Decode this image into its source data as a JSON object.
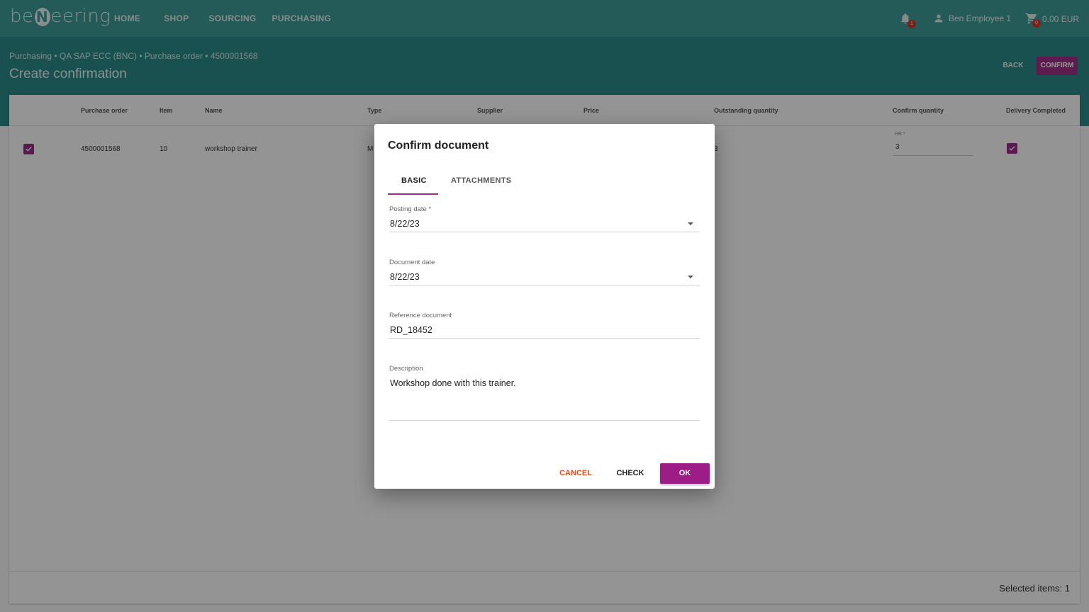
{
  "app": {
    "logo_text_left": "be",
    "logo_text_mid": "N",
    "logo_text_right": "eering"
  },
  "nav": {
    "items": [
      "HOME",
      "SHOP",
      "SOURCING",
      "PURCHASING"
    ]
  },
  "topbar": {
    "notification_count": "1",
    "user_name": "Ben Employee 1",
    "cart_count": "0",
    "cart_total": "0.00 EUR"
  },
  "header": {
    "breadcrumb": "Purchasing • QA SAP ECC (BNC) • Purchase order • 4500001568",
    "title": "Create confirmation",
    "back_label": "BACK",
    "confirm_label": "CONFIRM"
  },
  "table": {
    "columns": [
      "Purchase order",
      "Item",
      "Name",
      "Type",
      "Supplier",
      "Price",
      "Outstanding quantity",
      "Confirm quantity",
      "Delivery Completed"
    ],
    "rows": [
      {
        "selected": true,
        "purchase_order": "4500001568",
        "item": "10",
        "name": "workshop trainer",
        "type": "M",
        "outstanding_quantity": "3",
        "confirm_quantity_label": "HR *",
        "confirm_quantity": "3",
        "delivery_completed": true
      }
    ]
  },
  "footer": {
    "selected_items": "Selected items: 1"
  },
  "dialog": {
    "title": "Confirm document",
    "tabs": [
      "BASIC",
      "ATTACHMENTS"
    ],
    "active_tab": "BASIC",
    "fields": {
      "posting_date_label": "Posting date *",
      "posting_date": "8/22/23",
      "document_date_label": "Document date",
      "document_date": "8/22/23",
      "reference_document_label": "Reference document",
      "reference_document": "RD_18452",
      "description_label": "Description",
      "description": "Workshop done with this trainer."
    },
    "buttons": {
      "cancel": "CANCEL",
      "check": "CHECK",
      "ok": "OK"
    }
  },
  "colors": {
    "topbar": "#3f9e9a",
    "header": "#2a8c88",
    "accent": "#9c1d85",
    "cancel": "#e64a19",
    "badge": "#d23a2c"
  }
}
